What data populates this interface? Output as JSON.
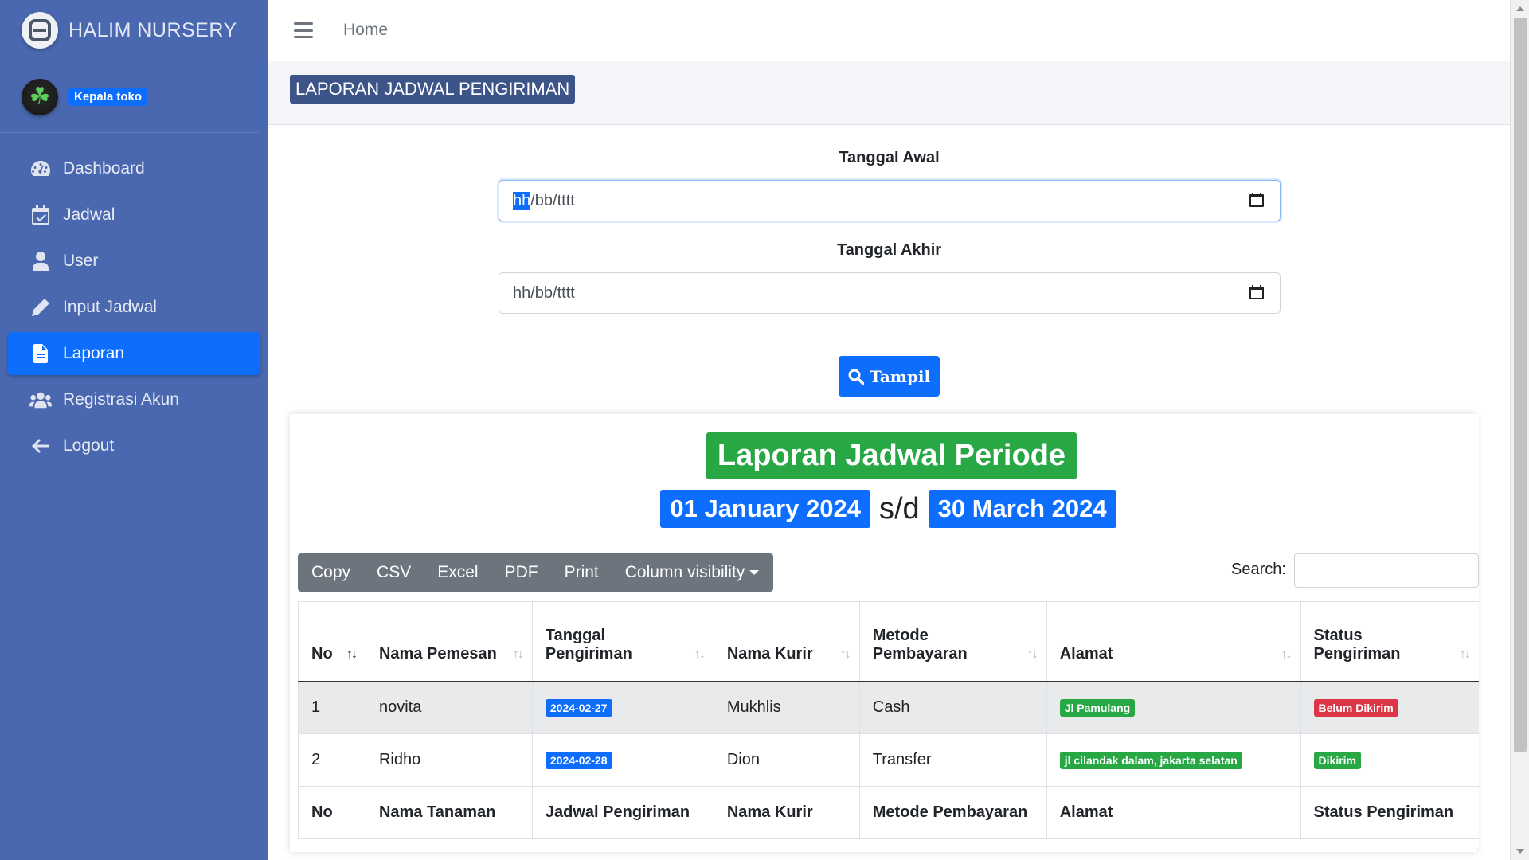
{
  "brand": {
    "name": "HALIM NURSERY"
  },
  "user": {
    "role": "Kepala toko"
  },
  "sidebar": {
    "items": [
      {
        "label": "Dashboard",
        "icon": "dashboard-icon"
      },
      {
        "label": "Jadwal",
        "icon": "calendar-check-icon"
      },
      {
        "label": "User",
        "icon": "user-icon"
      },
      {
        "label": "Input Jadwal",
        "icon": "pencil-icon"
      },
      {
        "label": "Laporan",
        "icon": "file-icon",
        "active": true
      },
      {
        "label": "Registrasi Akun",
        "icon": "users-icon"
      },
      {
        "label": "Logout",
        "icon": "arrow-left-icon"
      }
    ]
  },
  "topbar": {
    "home": "Home"
  },
  "page": {
    "title": "LAPORAN JADWAL PENGIRIMAN"
  },
  "form": {
    "start_label": "Tanggal Awal",
    "start_placeholder_highlight": "hh",
    "start_placeholder_rest": "/bb/tttt",
    "end_label": "Tanggal Akhir",
    "end_placeholder": "hh/bb/tttt",
    "submit_label": "Tampil"
  },
  "report": {
    "title": "Laporan Jadwal Periode",
    "date_from": "01 January 2024",
    "separator": "s/d",
    "date_to": "30 March 2024"
  },
  "toolbar": {
    "copy": "Copy",
    "csv": "CSV",
    "excel": "Excel",
    "pdf": "PDF",
    "print": "Print",
    "colvis": "Column visibility",
    "search_label": "Search:"
  },
  "table": {
    "headers": [
      "No",
      "Nama Pemesan",
      "Tanggal Pengiriman",
      "Nama Kurir",
      "Metode Pembayaran",
      "Alamat",
      "Status Pengiriman"
    ],
    "rows": [
      {
        "no": "1",
        "nama": "novita",
        "tanggal": "2024-02-27",
        "kurir": "Mukhlis",
        "metode": "Cash",
        "alamat": "Jl Pamulang",
        "status": "Belum Dikirim"
      },
      {
        "no": "2",
        "nama": "Ridho",
        "tanggal": "2024-02-28",
        "kurir": "Dion",
        "metode": "Transfer",
        "alamat": "jl cilandak dalam, jakarta selatan",
        "status": "Dikirim"
      }
    ],
    "footers": [
      "No",
      "Nama Tanaman",
      "Jadwal Pengiriman",
      "Nama Kurir",
      "Metode Pembayaran",
      "Alamat",
      "Status Pengiriman"
    ]
  },
  "colors": {
    "sidebar": "#4a68b0",
    "primary": "#0d6efd",
    "success": "#28a745",
    "danger": "#dc3545",
    "title_bg": "#3d5489"
  }
}
